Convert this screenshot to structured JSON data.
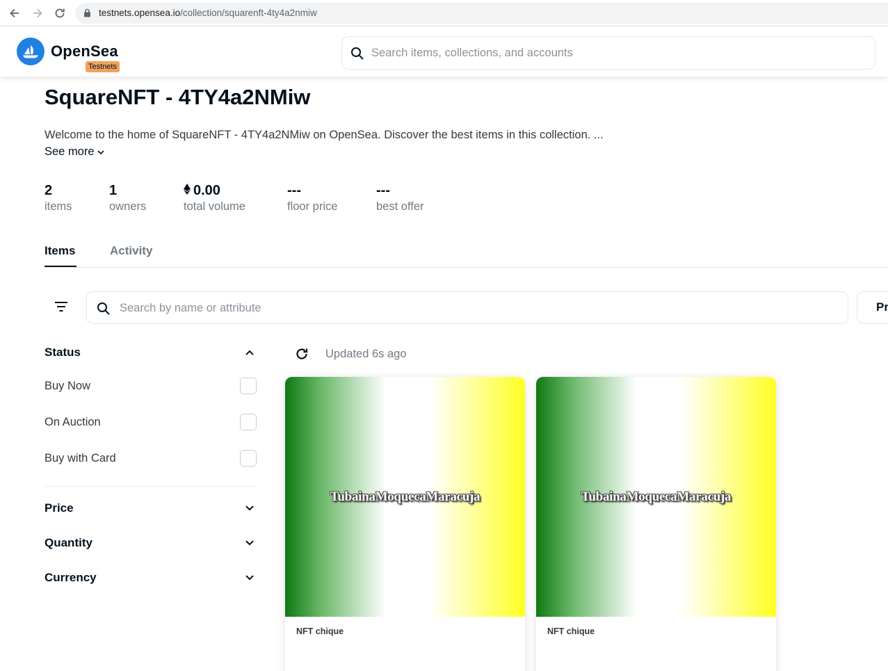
{
  "browser": {
    "url_host": "testnets.opensea.io",
    "url_path": "/collection/squarenft-4ty4a2nmiw"
  },
  "header": {
    "brand": "OpenSea",
    "badge": "Testnets",
    "search_placeholder": "Search items, collections, and accounts"
  },
  "collection": {
    "title": "SquareNFT - 4TY4a2NMiw",
    "description": "Welcome to the home of SquareNFT - 4TY4a2NMiw on OpenSea. Discover the best items in this collection. ...",
    "see_more": "See more"
  },
  "stats": [
    {
      "value": "2",
      "label": "items"
    },
    {
      "value": "1",
      "label": "owners"
    },
    {
      "value": "0.00",
      "label": "total volume",
      "eth": true
    },
    {
      "value": "---",
      "label": "floor price"
    },
    {
      "value": "---",
      "label": "best offer"
    }
  ],
  "tabs": [
    {
      "label": "Items",
      "active": true
    },
    {
      "label": "Activity",
      "active": false
    }
  ],
  "filter": {
    "search_placeholder": "Search by name or attribute",
    "sort_label": "Pr"
  },
  "sidebar": {
    "status_title": "Status",
    "status_options": [
      "Buy Now",
      "On Auction",
      "Buy with Card"
    ],
    "sections": [
      "Price",
      "Quantity",
      "Currency"
    ]
  },
  "main": {
    "updated_text": "Updated 6s ago"
  },
  "items": [
    {
      "name": "NFT chique",
      "image_text": "TubainaMoquecaMaracuja"
    },
    {
      "name": "NFT chique",
      "image_text": "TubainaMoquecaMaracuja"
    }
  ],
  "colors": {
    "brand_blue": "#2081e2",
    "testnets_badge": "#f0a25c",
    "text_primary": "#04111d",
    "text_secondary": "#707a83"
  }
}
